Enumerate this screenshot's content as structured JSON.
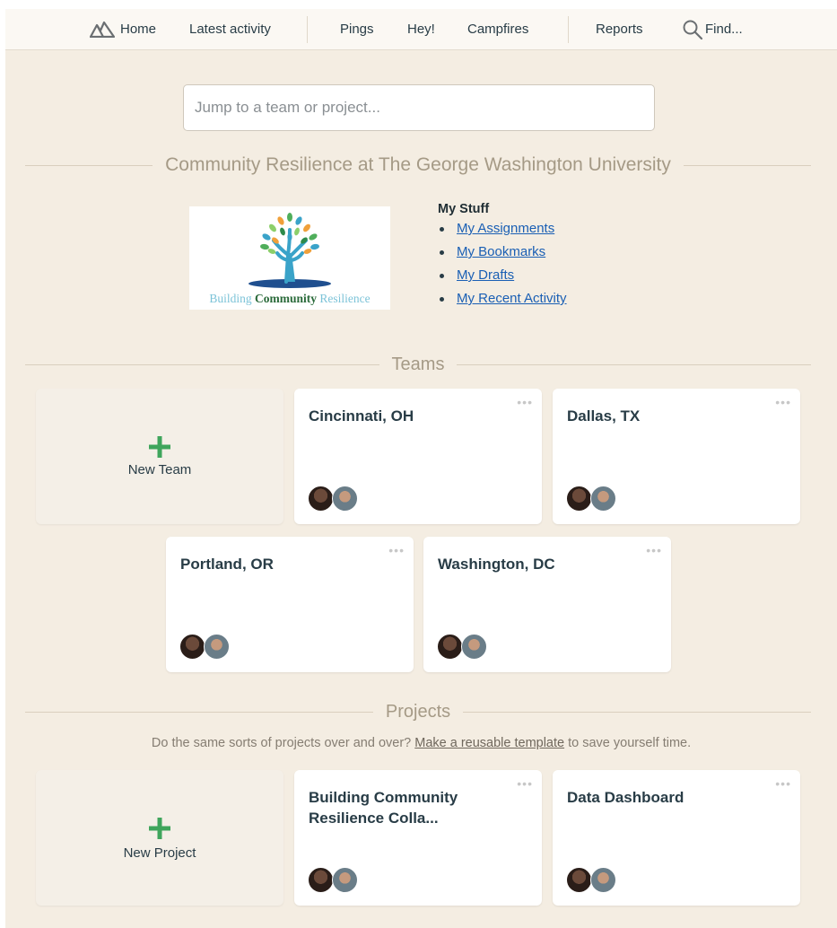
{
  "nav": {
    "home": "Home",
    "latest_activity": "Latest activity",
    "pings": "Pings",
    "hey": "Hey!",
    "campfires": "Campfires",
    "reports": "Reports",
    "find": "Find..."
  },
  "jump": {
    "placeholder": "Jump to a team or project..."
  },
  "account": {
    "name": "Community Resilience at The George Washington University",
    "logo_caption": {
      "part1": "Building ",
      "part2": "Community",
      "part3": " Resilience"
    }
  },
  "my_stuff": {
    "heading": "My Stuff",
    "links": [
      "My Assignments",
      "My Bookmarks",
      "My Drafts",
      "My Recent Activity"
    ]
  },
  "teams": {
    "heading": "Teams",
    "new_label": "New Team",
    "items": [
      "Cincinnati, OH",
      "Dallas, TX",
      "Portland, OR",
      "Washington, DC"
    ]
  },
  "projects": {
    "heading": "Projects",
    "note_before": "Do the same sorts of projects over and over? ",
    "note_link": "Make a reusable template",
    "note_after": " to save yourself time.",
    "new_label": "New Project",
    "items": [
      "Building Community Resilience Colla...",
      "Data Dashboard"
    ]
  },
  "colors": {
    "page_bg": "#f4ede2",
    "nav_bg": "#fbf8f3",
    "plus_green": "#3fa55c",
    "link_blue": "#1a5fb4",
    "heading_tan": "#a59a86"
  },
  "icons": {
    "home": "basecamp-mountain-icon",
    "find": "magnifier-icon",
    "menu": "ellipsis-icon"
  }
}
